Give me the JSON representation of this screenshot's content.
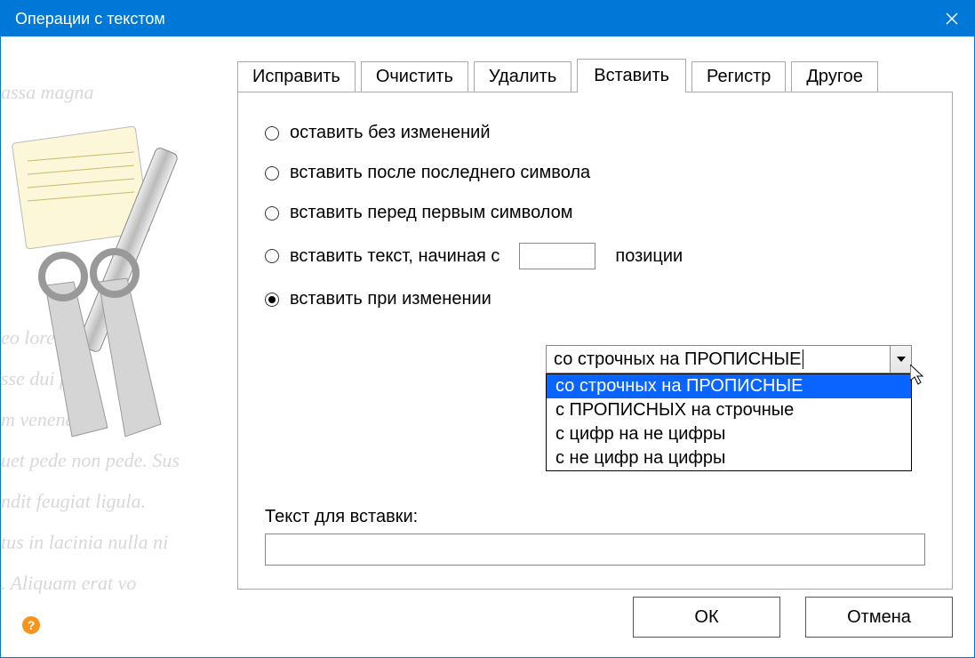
{
  "window": {
    "title": "Операции с текстом"
  },
  "tabs": {
    "t0": "Исправить",
    "t1": "Очистить",
    "t2": "Удалить",
    "t3": "Вставить",
    "t4": "Регистр",
    "t5": "Другое",
    "active": 3
  },
  "radios": {
    "r0": "оставить без изменений",
    "r1": "вставить после последнего символа",
    "r2": "вставить перед первым символом",
    "r3_pre": "вставить текст, начиная с",
    "r3_post": "позиции",
    "r3_value": "",
    "r4": "вставить при изменении"
  },
  "combo": {
    "selected": "со строчных на ПРОПИСНЫЕ",
    "options": {
      "o0": "со строчных на ПРОПИСНЫЕ",
      "o1": "с ПРОПИСНЫХ на строчные",
      "o2": "с цифр на не цифры",
      "o3": "с не цифр на цифры"
    }
  },
  "insert": {
    "label": "Текст для вставки:",
    "value": ""
  },
  "buttons": {
    "ok": "ОК",
    "cancel": "Отмена"
  },
  "sideText": "assa magna\\n\\n\\n\\n\\n\\neo lorem,\\nsse dui pos\\nm venenat\\nuet pede non pede. Sus\\nndit feugiat ligula.\\ntus in lacinia nulla ni\\n. Aliquam erat vo",
  "help": "?"
}
